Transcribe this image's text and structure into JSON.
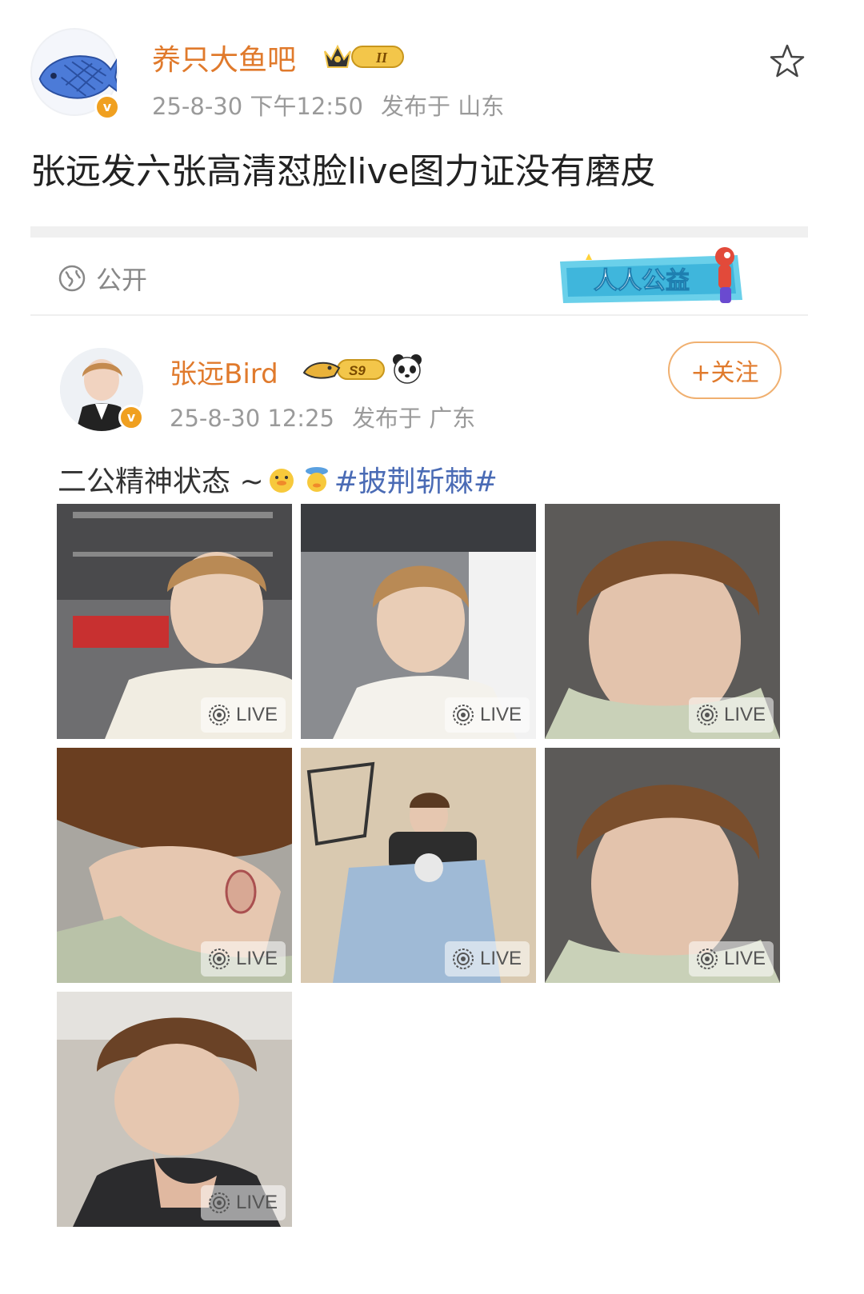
{
  "outer_post": {
    "author": "养只大鱼吧",
    "date": "25-8-30 下午12:50",
    "location": "发布于 山东",
    "title": "张远发六张高清怼脸live图力证没有磨皮",
    "visibility": "公开",
    "charity_banner_text": "人人公益"
  },
  "inner_post": {
    "author": "张远Bird",
    "level_badge": "S9",
    "follow_label": "+关注",
    "date": "25-8-30 12:25",
    "location": "发布于 广东",
    "caption_text": "二公精神状态 ~",
    "hashtag": "#披荆斩棘#"
  },
  "photos": [
    {
      "live_label": "LIVE",
      "desc": "photo-1"
    },
    {
      "live_label": "LIVE",
      "desc": "photo-2"
    },
    {
      "live_label": "LIVE",
      "desc": "photo-3"
    },
    {
      "live_label": "LIVE",
      "desc": "photo-4"
    },
    {
      "live_label": "LIVE",
      "desc": "photo-5"
    },
    {
      "live_label": "LIVE",
      "desc": "photo-6"
    },
    {
      "live_label": "LIVE",
      "desc": "photo-7"
    }
  ],
  "colors": {
    "accent_orange": "#e07a2c",
    "hashtag_blue": "#4a6bb5",
    "meta_gray": "#9a9a9a"
  }
}
